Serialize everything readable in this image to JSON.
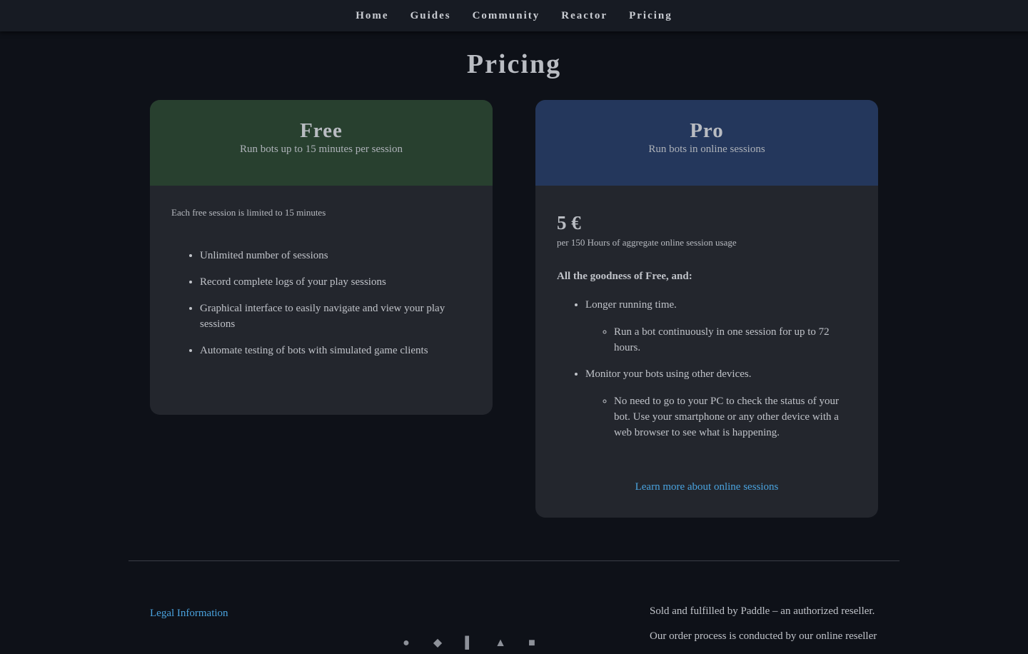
{
  "nav": {
    "items": [
      {
        "label": "Home"
      },
      {
        "label": "Guides"
      },
      {
        "label": "Community"
      },
      {
        "label": "Reactor"
      },
      {
        "label": "Pricing"
      }
    ]
  },
  "page": {
    "title": "Pricing"
  },
  "plans": {
    "free": {
      "name": "Free",
      "subtitle": "Run bots up to 15 minutes per session",
      "header_color": "#28402f",
      "note": "Each free session is limited to 15 minutes",
      "features": [
        "Unlimited number of sessions",
        "Record complete logs of your play sessions",
        "Graphical interface to easily navigate and view your play sessions",
        "Automate testing of bots with simulated game clients"
      ]
    },
    "pro": {
      "name": "Pro",
      "subtitle": "Run bots in online sessions",
      "header_color": "#24375c",
      "price": "5 €",
      "price_note": "per 150 Hours of aggregate online session usage",
      "intro": "All the goodness of Free, and:",
      "features": [
        {
          "label": "Longer running time.",
          "details": [
            "Run a bot continuously in one session for up to 72 hours."
          ]
        },
        {
          "label": "Monitor your bots using other devices.",
          "details": [
            "No need to go to your PC to check the status of your bot. Use your smartphone or any other device with a web browser to see what is happening."
          ]
        }
      ],
      "link_label": "Learn more about online sessions"
    }
  },
  "footer": {
    "legal_label": "Legal Information",
    "social_icons": [
      "github-icon",
      "discord-icon",
      "youtube-icon",
      "twitter-icon",
      "forum-icon"
    ],
    "reseller_lines": [
      "Sold and fulfilled by Paddle – an authorized reseller.",
      "Our order process is conducted by our online reseller"
    ]
  },
  "colors": {
    "background": "#0e1118",
    "nav_background": "#171b23",
    "card_background": "#23262d",
    "link": "#4aa3df"
  }
}
